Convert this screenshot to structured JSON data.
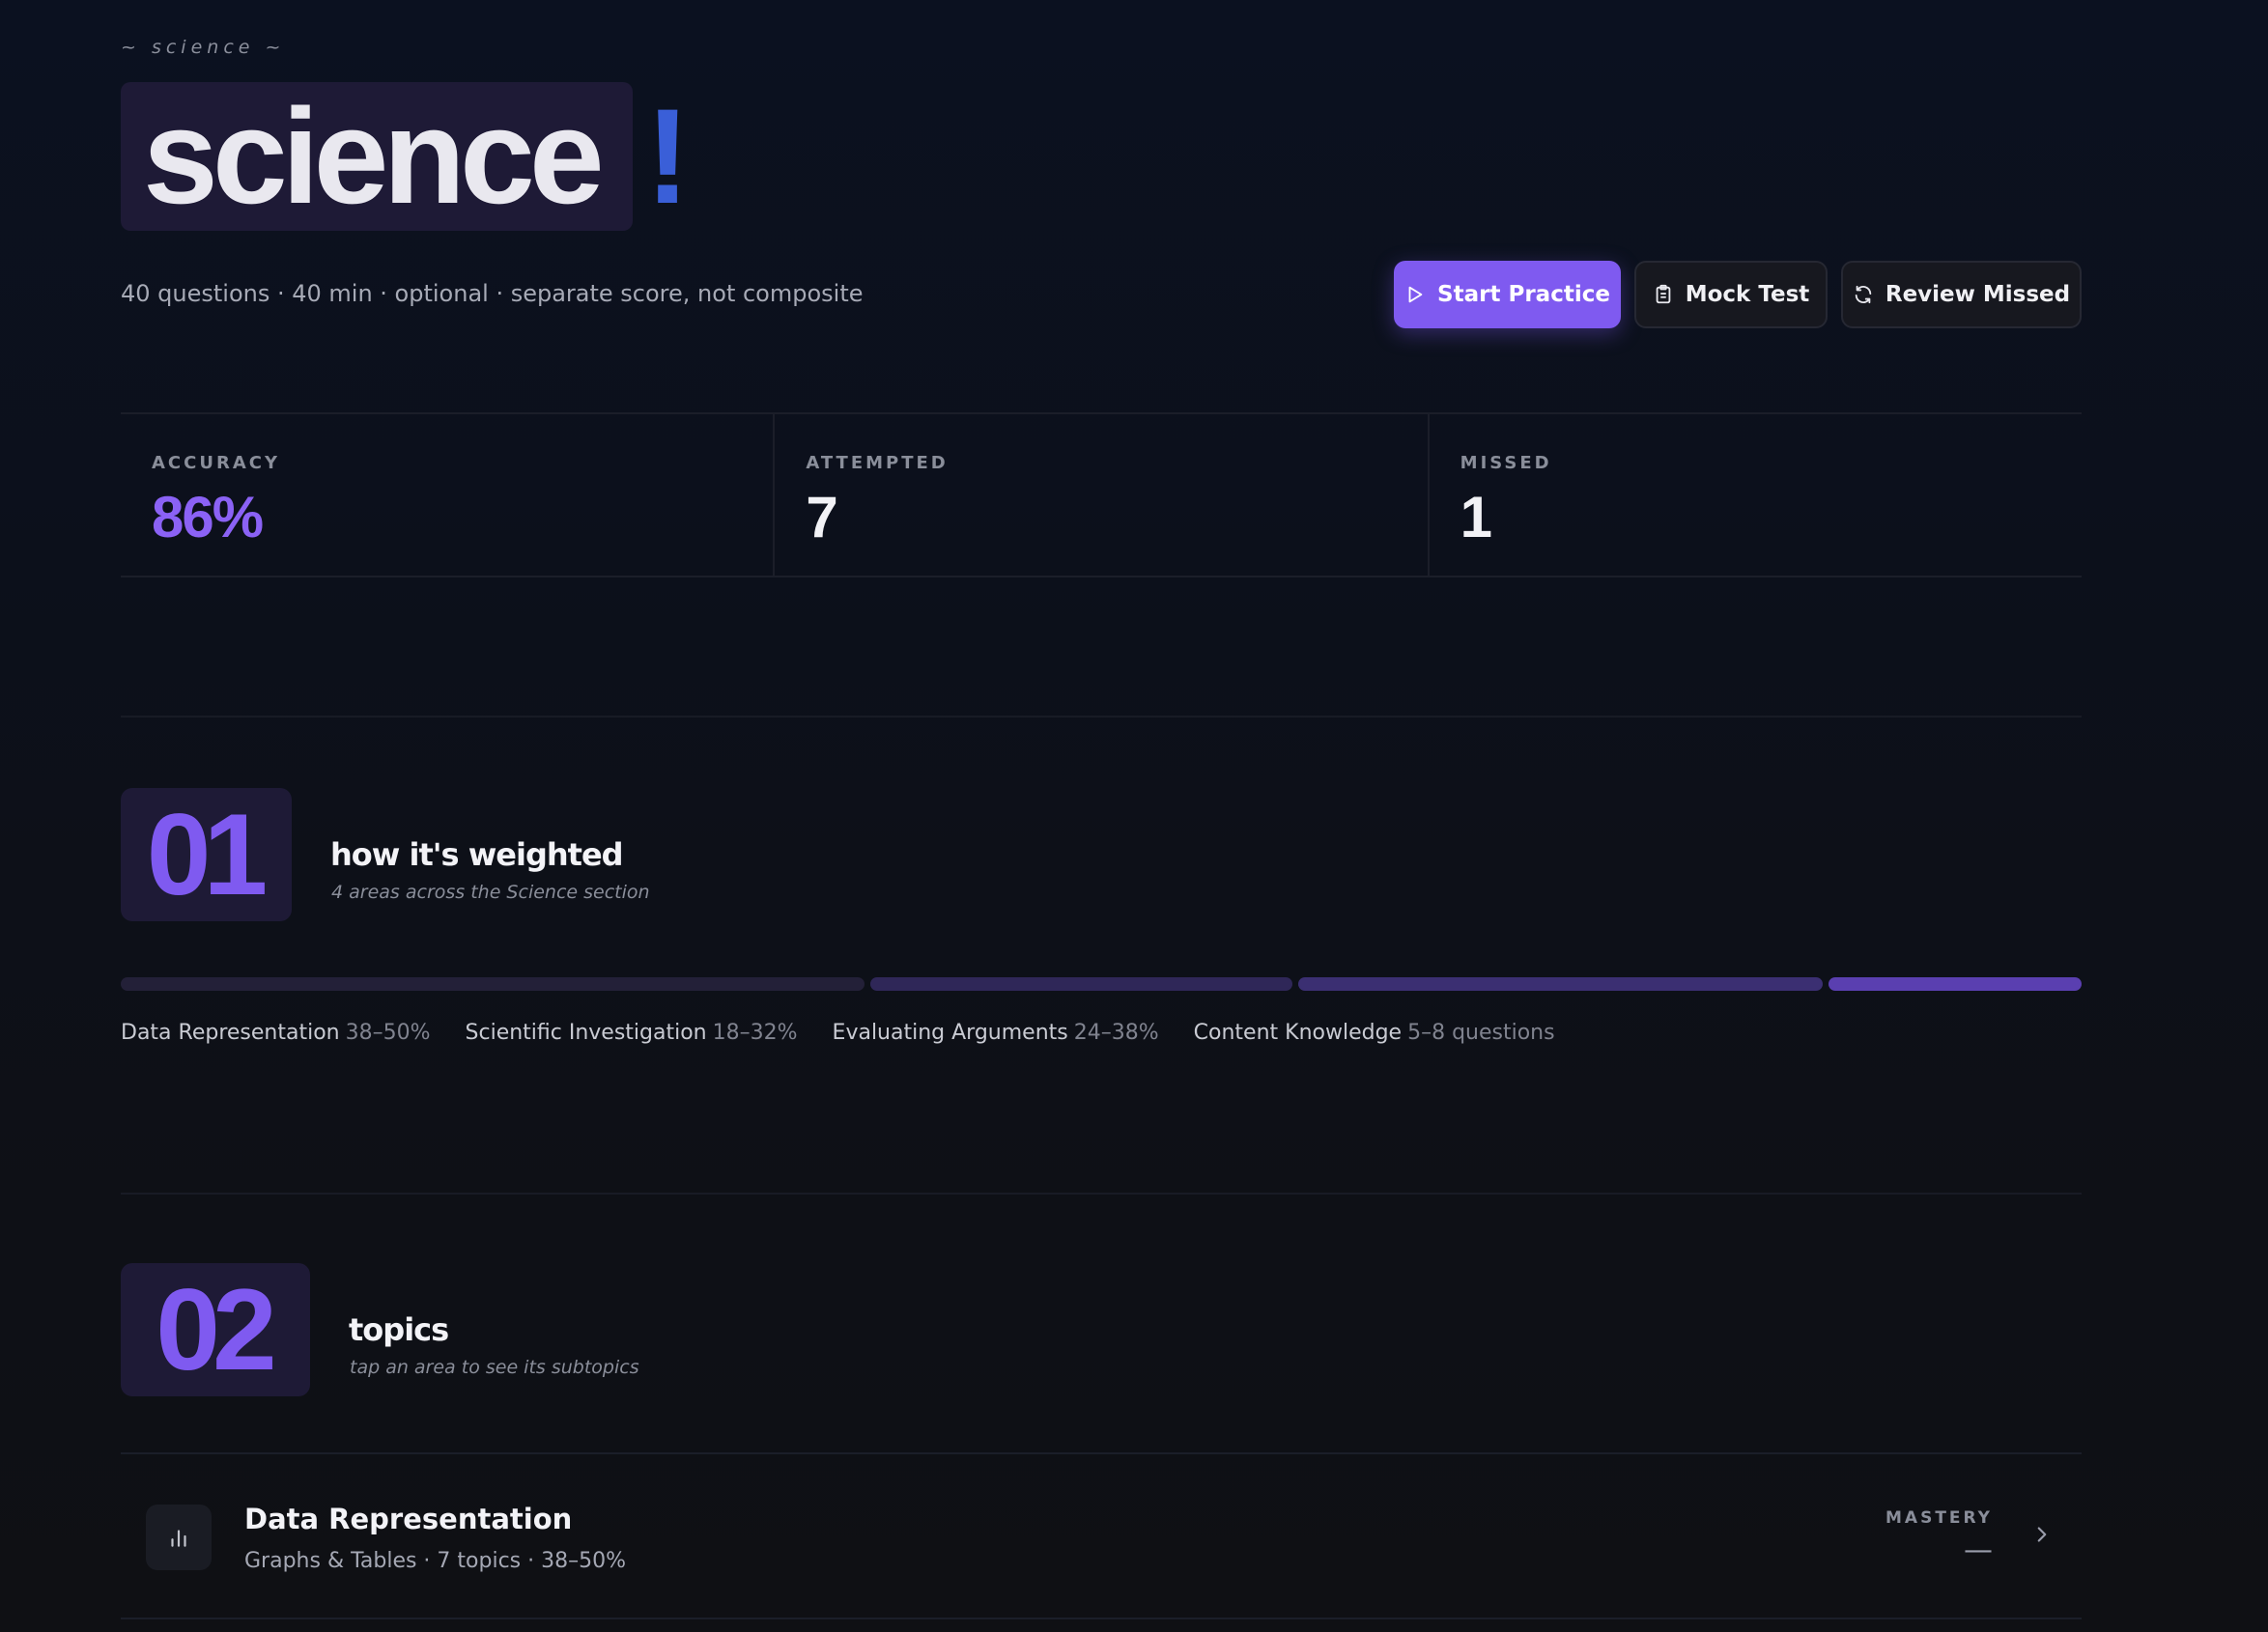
{
  "header": {
    "eyebrow": "~ science ~",
    "title": "science",
    "exclaim": "!",
    "subtitle": "40 questions · 40 min · optional · separate score, not composite"
  },
  "actions": {
    "start_practice": "Start Practice",
    "mock_test": "Mock Test",
    "review_missed": "Review Missed"
  },
  "stats": [
    {
      "label": "ACCURACY",
      "value": "86%"
    },
    {
      "label": "ATTEMPTED",
      "value": "7"
    },
    {
      "label": "MISSED",
      "value": "1"
    }
  ],
  "weighting": {
    "number": "01",
    "title": "how it's weighted",
    "subtitle": "4 areas across the Science section",
    "areas": [
      {
        "name": "Data Representation",
        "range": "38–50%",
        "color": "#232038"
      },
      {
        "name": "Scientific Investigation",
        "range": "18–32%",
        "color": "#2f2758"
      },
      {
        "name": "Evaluating Arguments",
        "range": "24–38%",
        "color": "#3b2f72"
      },
      {
        "name": "Content Knowledge",
        "range": "5–8 questions",
        "color": "#5a3fb0"
      }
    ]
  },
  "topics": {
    "number": "02",
    "title": "topics",
    "subtitle": "tap an area to see its subtopics",
    "items": [
      {
        "title": "Data Representation",
        "meta": "Graphs & Tables · 7 topics · 38–50%",
        "mastery_label": "MASTERY",
        "mastery_value": "—",
        "icon": "bar-chart-icon"
      }
    ]
  },
  "colors": {
    "accent": "#7f5af0",
    "accent_text": "#8b62f5",
    "exclaim": "#3a5fd8",
    "background": "#0b1120"
  }
}
